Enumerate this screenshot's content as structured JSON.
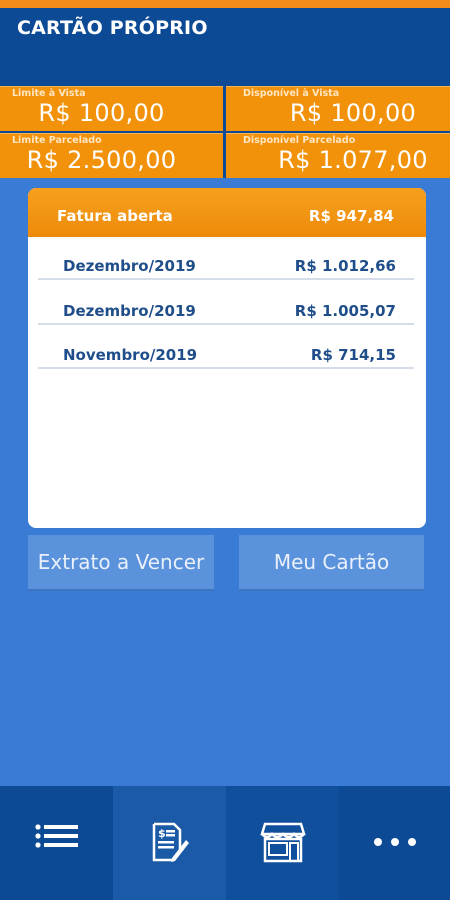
{
  "header": {
    "title": "CARTÃO PRÓPRIO"
  },
  "limits": [
    {
      "label": "Limite à Vista",
      "value": "R$ 100,00"
    },
    {
      "label": "Disponível à Vista",
      "value": "R$ 100,00"
    },
    {
      "label": "Limite Parcelado",
      "value": "R$ 2.500,00"
    },
    {
      "label": "Disponível Parcelado",
      "value": "R$ 1.077,00"
    }
  ],
  "open_invoice": {
    "label": "Fatura aberta",
    "amount": "R$ 947,84"
  },
  "invoices": [
    {
      "month": "Dezembro/2019",
      "value": "R$ 1.012,66"
    },
    {
      "month": "Dezembro/2019",
      "value": "R$ 1.005,07"
    },
    {
      "month": "Novembro/2019",
      "value": "R$ 714,15"
    }
  ],
  "actions": {
    "extrato": "Extrato a Vencer",
    "cartao": "Meu Cartão"
  },
  "bottom_nav": [
    {
      "icon": "list-icon"
    },
    {
      "icon": "invoice-edit-icon"
    },
    {
      "icon": "store-icon"
    },
    {
      "icon": "more-icon"
    }
  ],
  "colors": {
    "primary": "#0d4a96",
    "accent": "#f2920a",
    "background": "#3a7bd5"
  }
}
